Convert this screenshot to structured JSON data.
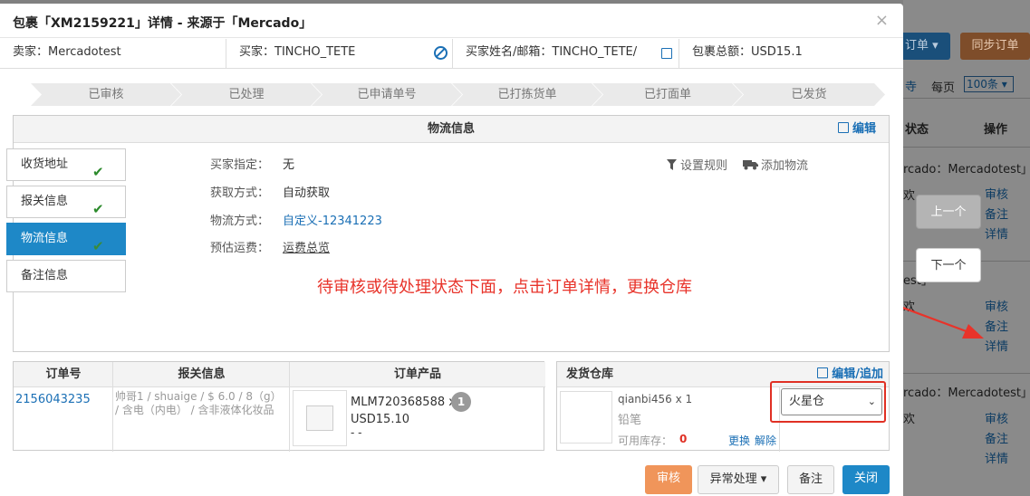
{
  "background": {
    "btn_order": "订单",
    "btn_sync": "同步订单",
    "partial_link": "寺",
    "per_page_label": "每页",
    "per_page_value": "100条",
    "col_status": "状态",
    "col_action": "操作",
    "groups": [
      {
        "header": "rcado：Mercadotest」",
        "frag": "欢",
        "links": [
          "审核",
          "备注",
          "详情"
        ]
      },
      {
        "header": "est」",
        "frag": "欢",
        "links": [
          "审核",
          "备注",
          "详情"
        ]
      },
      {
        "header": "rcado：Mercadotest」",
        "frag": "欢",
        "links": [
          "审核",
          "备注",
          "详情"
        ]
      }
    ],
    "prev_label": "上一个",
    "next_label": "下一个"
  },
  "modal": {
    "title": "包裹「XM2159221」详情 - 来源于「Mercado」",
    "close": "×",
    "info": {
      "seller": "卖家：Mercadotest",
      "buyer": "买家：TINCHO_TETE",
      "buyer_name_email": "买家姓名/邮箱：TINCHO_TETE/",
      "total": "包裹总额：USD15.1"
    },
    "steps": [
      "已审核",
      "已处理",
      "已申请单号",
      "已打拣货单",
      "已打面单",
      "已发货"
    ],
    "logistics": {
      "header": "物流信息",
      "edit": "编辑",
      "tabs": [
        "收货地址",
        "报关信息",
        "物流信息",
        "备注信息"
      ],
      "active_tab": 2,
      "fields": [
        {
          "label": "买家指定：",
          "value": "无"
        },
        {
          "label": "获取方式：",
          "value": "自动获取"
        },
        {
          "label": "物流方式：",
          "value": "自定义-12341223"
        },
        {
          "label": "预估运费：",
          "value": "运费总览"
        }
      ],
      "set_rule": "设置规则",
      "add_logistics": "添加物流"
    },
    "annotation": "待审核或待处理状态下面，点击订单详情，更换仓库",
    "order_table": {
      "headers": [
        "订单号",
        "报关信息",
        "订单产品"
      ],
      "order_no": "2156043235",
      "customs": "帅哥1 / shuaige / $ 6.0 / 8（g） / 含电（内电） / 含非液体化妆品",
      "product_sku": "MLM720368588 x",
      "product_qty": "1",
      "product_price": "USD15.10",
      "product_extra": "- -"
    },
    "warehouse": {
      "header": "发货仓库",
      "edit": "编辑/追加",
      "item": "qianbi456 x 1",
      "item_name": "铅笔",
      "stock_label": "可用库存：",
      "stock_value": "0",
      "replace": "更换",
      "unbind": "解除",
      "selected": "火星仓"
    },
    "buttons": {
      "audit": "审核",
      "exception": "异常处理",
      "note": "备注",
      "close": "关闭"
    }
  },
  "colors": {
    "primary": "#1e88c7",
    "orange": "#f0955a",
    "annotation": "#e8332a",
    "success": "#2b8a2b"
  }
}
